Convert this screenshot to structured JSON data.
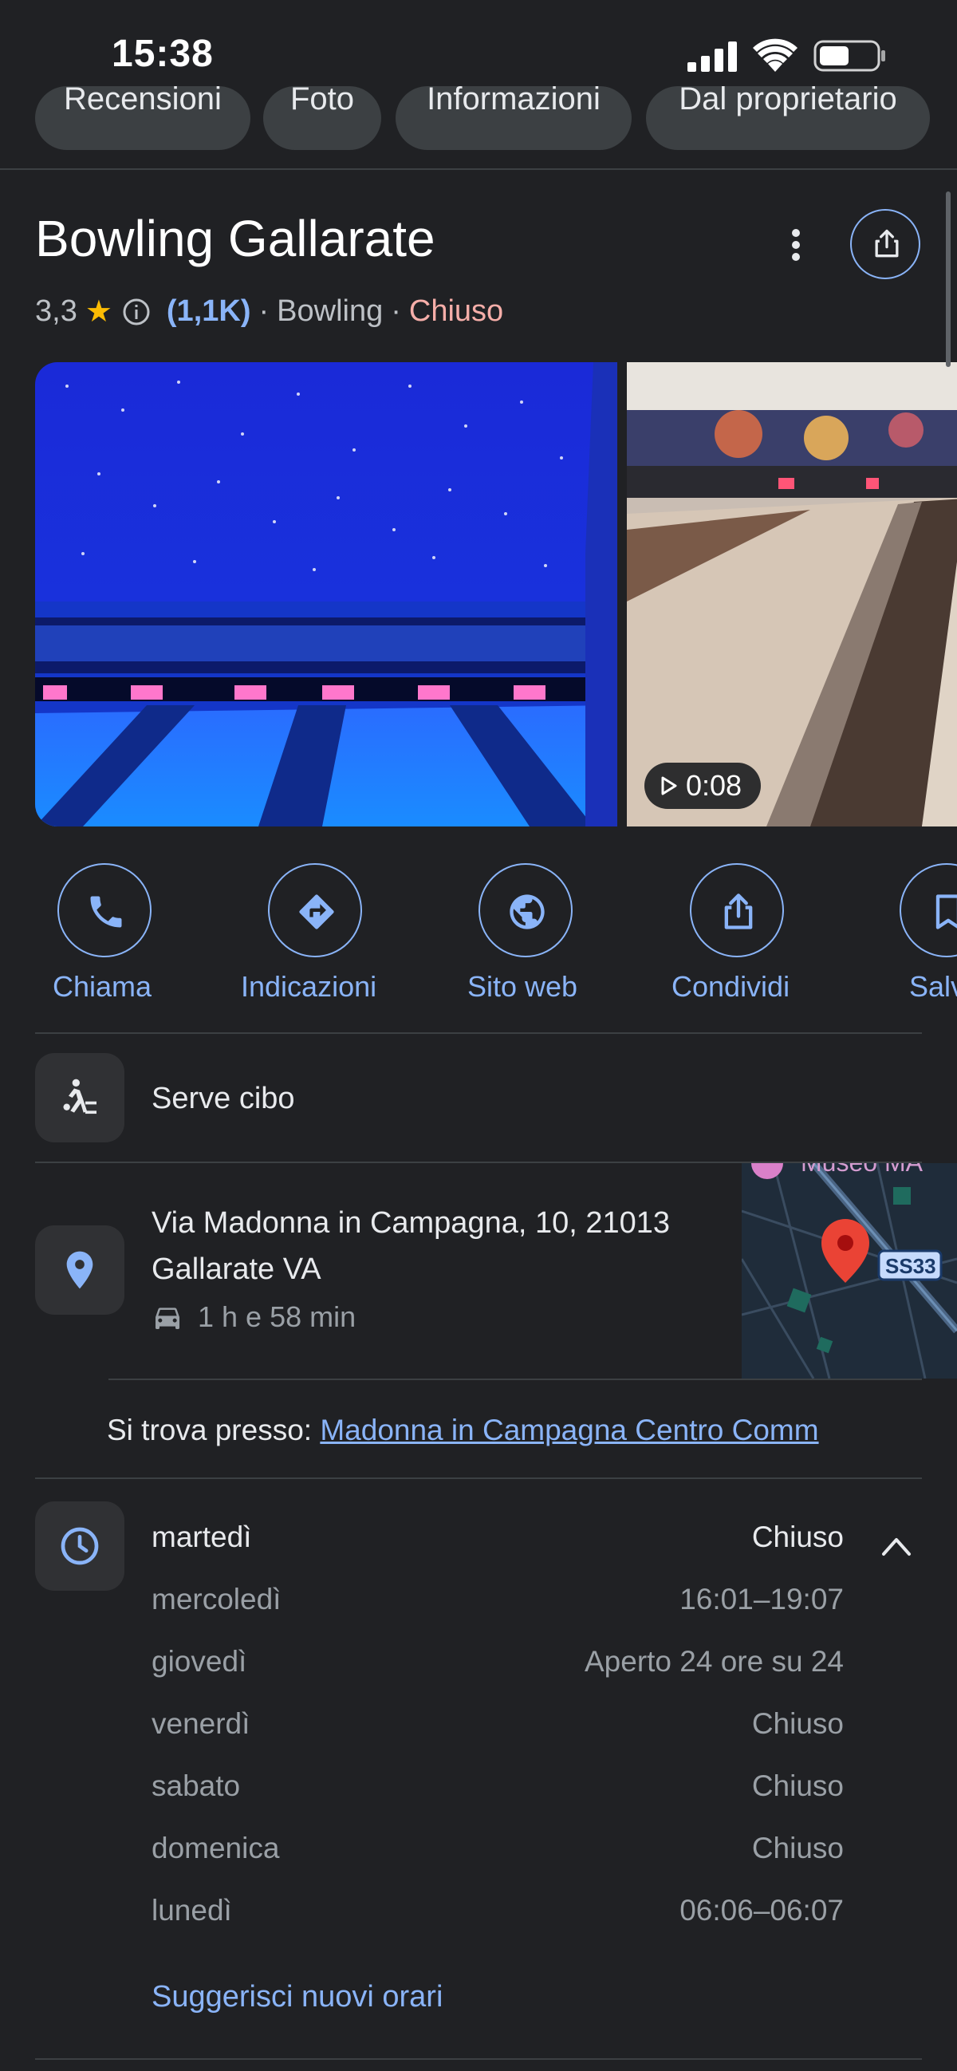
{
  "status_bar": {
    "time": "15:38"
  },
  "tabs": [
    {
      "label": "Recensioni"
    },
    {
      "label": "Foto"
    },
    {
      "label": "Informazioni"
    },
    {
      "label": "Dal proprietario"
    }
  ],
  "place": {
    "name": "Bowling Gallarate",
    "rating": "3,3",
    "reviews_count": "(1,1K)",
    "category": "Bowling",
    "separator": "·",
    "status": "Chiuso"
  },
  "photos": {
    "video_duration": "0:08"
  },
  "actions": [
    {
      "label": "Chiama",
      "icon": "phone-icon"
    },
    {
      "label": "Indicazioni",
      "icon": "directions-icon"
    },
    {
      "label": "Sito web",
      "icon": "globe-icon"
    },
    {
      "label": "Condividi",
      "icon": "share-icon"
    },
    {
      "label": "Salv",
      "icon": "bookmark-icon"
    }
  ],
  "features": {
    "food": "Serve cibo"
  },
  "address": {
    "line1": "Via Madonna in Campagna, 10, 21013",
    "line2": "Gallarate VA",
    "travel_time": "1 h e 58 min",
    "map_poi": "Museo MA",
    "map_road": "SS33"
  },
  "located_in": {
    "prefix": "Si trova presso:",
    "link": "Madonna in Campagna Centro Comm"
  },
  "hours": [
    {
      "day": "martedì",
      "time": "Chiuso"
    },
    {
      "day": "mercoledì",
      "time": "16:01–19:07"
    },
    {
      "day": "giovedì",
      "time": "Aperto 24 ore su 24"
    },
    {
      "day": "venerdì",
      "time": "Chiuso"
    },
    {
      "day": "sabato",
      "time": "Chiuso"
    },
    {
      "day": "domenica",
      "time": "Chiuso"
    },
    {
      "day": "lunedì",
      "time": "06:06–06:07"
    }
  ],
  "suggest_hours": "Suggerisci nuovi orari",
  "colors": {
    "background": "#202124",
    "accent": "#8ab4f8",
    "closed": "#f6aea9",
    "star": "#fbbc04"
  }
}
